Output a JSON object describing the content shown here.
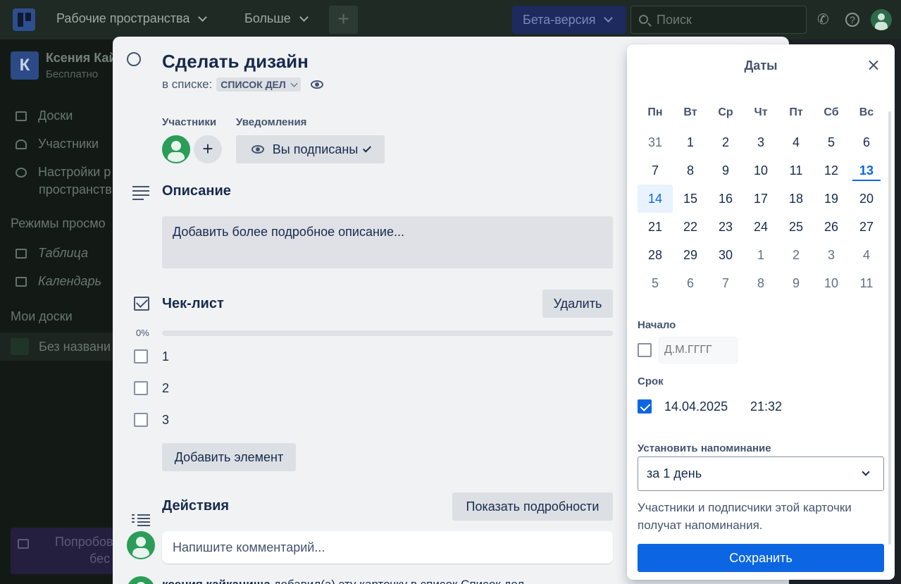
{
  "topbar": {
    "workspaces": "Рабочие пространства",
    "more": "Больше",
    "add": "+",
    "beta": "Бета-версия",
    "search_placeholder": "Поиск"
  },
  "sidebar": {
    "workspace_initial": "К",
    "workspace_name": "Ксения Кай",
    "workspace_plan": "Бесплатно",
    "items": [
      {
        "label": "Доски"
      },
      {
        "label": "Участники"
      },
      {
        "label": "Настройки р"
      },
      {
        "label": "пространств"
      }
    ],
    "views_heading": "Режимы просмо",
    "views": [
      {
        "label": "Таблица"
      },
      {
        "label": "Календарь"
      }
    ],
    "boards_heading": "Мои доски",
    "board_name": "Без названи",
    "try_line1": "Попробов",
    "try_line2": "бес"
  },
  "card": {
    "title": "Сделать дизайн",
    "in_list_label": "в списке:",
    "list_name": "СПИСОК ДЕЛ",
    "members_label": "Участники",
    "notifications_label": "Уведомления",
    "add_member": "+",
    "subscribed_label": "Вы подписаны",
    "description_heading": "Описание",
    "description_placeholder": "Добавить более подробное описание...",
    "checklist_heading": "Чек-лист",
    "delete_label": "Удалить",
    "progress_text": "0%",
    "progress_value": 0,
    "checklist_items": [
      {
        "label": "1",
        "checked": false
      },
      {
        "label": "2",
        "checked": false
      },
      {
        "label": "3",
        "checked": false
      }
    ],
    "add_item_label": "Добавить элемент",
    "activity_heading": "Действия",
    "show_details_label": "Показать подробности",
    "comment_placeholder": "Напишите комментарий...",
    "feed_author": "ксения кайкацища",
    "feed_text": " добавил(а) эту карточку в список Список дел"
  },
  "dates": {
    "title": "Даты",
    "weekdays": [
      "Пн",
      "Вт",
      "Ср",
      "Чт",
      "Пт",
      "Сб",
      "Вс"
    ],
    "weeks": [
      [
        "31",
        "1",
        "2",
        "3",
        "4",
        "5",
        "6"
      ],
      [
        "7",
        "8",
        "9",
        "10",
        "11",
        "12",
        "13"
      ],
      [
        "14",
        "15",
        "16",
        "17",
        "18",
        "19",
        "20"
      ],
      [
        "21",
        "22",
        "23",
        "24",
        "25",
        "26",
        "27"
      ],
      [
        "28",
        "29",
        "30",
        "1",
        "2",
        "3",
        "4"
      ],
      [
        "5",
        "6",
        "7",
        "8",
        "9",
        "10",
        "11"
      ]
    ],
    "start_label": "Начало",
    "start_placeholder": "Д.М.ГГГГ",
    "start_checked": false,
    "due_label": "Срок",
    "due_checked": true,
    "due_date": "14.04.2025",
    "due_time": "21:32",
    "reminder_label": "Установить напоминание",
    "reminder_value": "за 1 день",
    "hint": "Участники и подписчики этой карточки получат напоминания.",
    "save_label": "Сохранить"
  },
  "colors": {
    "accent": "#0c66e4",
    "avatar": "#2b9d59"
  }
}
